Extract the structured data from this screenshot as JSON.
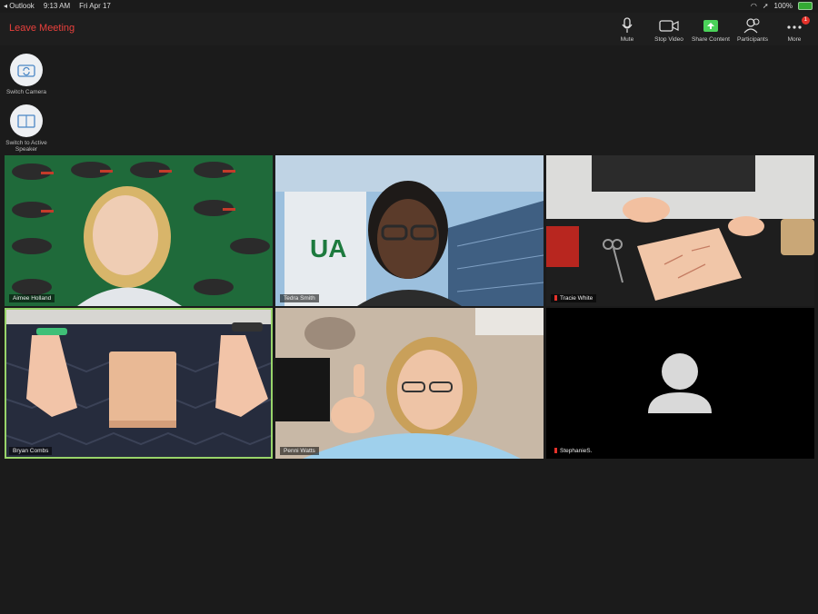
{
  "statusbar": {
    "app": "◂ Outlook",
    "time": "9:13 AM",
    "date": "Fri Apr 17",
    "battery": "100%"
  },
  "topbar": {
    "leave": "Leave Meeting",
    "buttons": {
      "mute": "Mute",
      "stop_video": "Stop Video",
      "share": "Share Content",
      "participants": "Participants",
      "more": "More",
      "more_badge": "1"
    }
  },
  "side": {
    "switch_camera": "Switch Camera",
    "switch_active": "Switch to Active Speaker"
  },
  "participants": [
    {
      "name": "Aimee Holland"
    },
    {
      "name": "Tedra Smith"
    },
    {
      "name": "Tracie White"
    },
    {
      "name": "Bryan Combs"
    },
    {
      "name": "Penni Watts"
    },
    {
      "name": "StephanieS."
    }
  ],
  "colors": {
    "leave": "#e8403c",
    "active_border": "#98d46a",
    "share_icon": "#4bd35a"
  }
}
